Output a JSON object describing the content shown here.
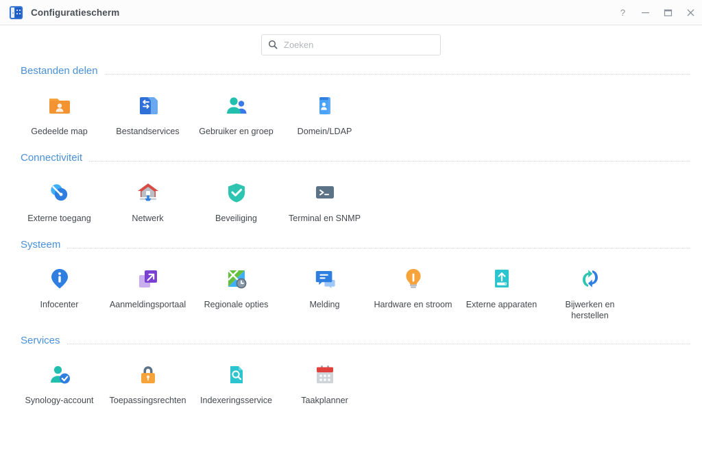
{
  "window": {
    "title": "Configuratiescherm",
    "app_icon": "control-panel-icon",
    "buttons": [
      {
        "name": "help-button",
        "glyph": "?"
      },
      {
        "name": "minimize-button",
        "glyph": "–"
      },
      {
        "name": "maximize-button",
        "glyph": "□"
      },
      {
        "name": "close-button",
        "glyph": "✕"
      }
    ]
  },
  "search": {
    "icon": "search-icon",
    "placeholder": "Zoeken",
    "value": ""
  },
  "sections": [
    {
      "id": "bestanden-delen",
      "title": "Bestanden delen",
      "items": [
        {
          "label": "Gedeelde map",
          "icon": "shared-folder-icon"
        },
        {
          "label": "Bestandservices",
          "icon": "file-services-icon"
        },
        {
          "label": "Gebruiker en groep",
          "icon": "user-group-icon"
        },
        {
          "label": "Domein/LDAP",
          "icon": "domain-ldap-icon"
        }
      ]
    },
    {
      "id": "connectiviteit",
      "title": "Connectiviteit",
      "items": [
        {
          "label": "Externe toegang",
          "icon": "external-access-icon"
        },
        {
          "label": "Netwerk",
          "icon": "network-icon"
        },
        {
          "label": "Beveiliging",
          "icon": "security-shield-icon"
        },
        {
          "label": "Terminal en SNMP",
          "icon": "terminal-snmp-icon"
        }
      ]
    },
    {
      "id": "systeem",
      "title": "Systeem",
      "items": [
        {
          "label": "Infocenter",
          "icon": "info-center-icon"
        },
        {
          "label": "Aanmeldingsportaal",
          "icon": "login-portal-icon"
        },
        {
          "label": "Regionale opties",
          "icon": "regional-options-icon"
        },
        {
          "label": "Melding",
          "icon": "notification-icon"
        },
        {
          "label": "Hardware en stroom",
          "icon": "hardware-power-icon"
        },
        {
          "label": "Externe apparaten",
          "icon": "external-devices-icon"
        },
        {
          "label": "Bijwerken en herstellen",
          "icon": "update-restore-icon"
        }
      ]
    },
    {
      "id": "services",
      "title": "Services",
      "items": [
        {
          "label": "Synology-account",
          "icon": "synology-account-icon"
        },
        {
          "label": "Toepassingsrechten",
          "icon": "application-privileges-icon"
        },
        {
          "label": "Indexeringsservice",
          "icon": "indexing-service-icon"
        },
        {
          "label": "Taakplanner",
          "icon": "task-scheduler-icon"
        }
      ]
    }
  ],
  "colors": {
    "accent": "#4a90d9",
    "title_text": "#4a4f56",
    "label_text": "#44484e",
    "placeholder": "#b2b6bb",
    "window_bg": "#ffffff"
  }
}
